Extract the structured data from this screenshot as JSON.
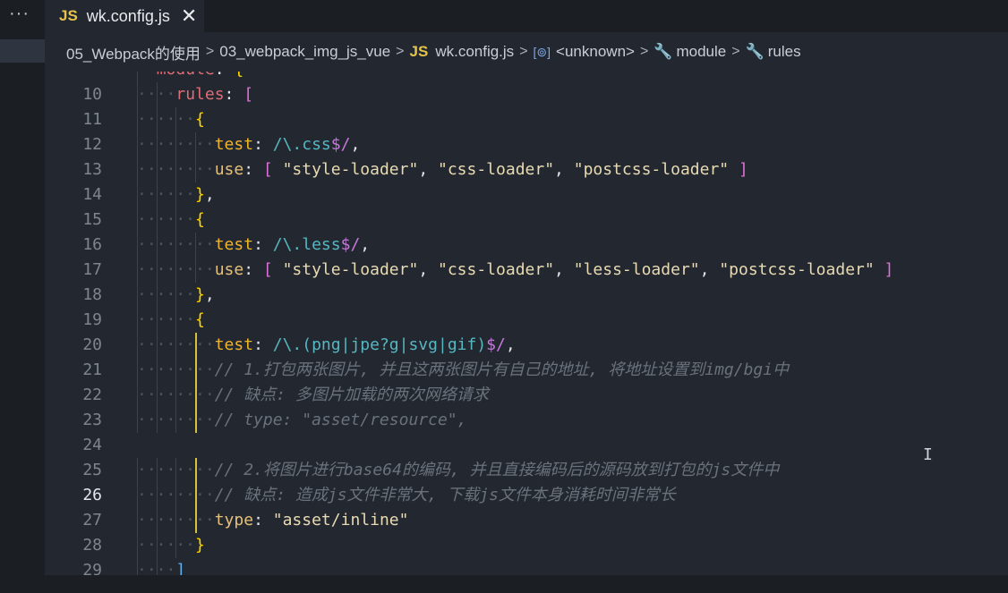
{
  "app": {
    "tab": {
      "icon": "JS",
      "filename": "wk.config.js",
      "close": "✕"
    },
    "breadcrumb": {
      "items": [
        "05_Webpack的使用",
        "03_webpack_img_js_vue",
        "wk.config.js",
        "<unknown>",
        "module",
        "rules"
      ],
      "js_icon": "JS"
    },
    "cursor_line": 26
  },
  "lines": [
    {
      "n": "",
      "text": "module: {"
    },
    {
      "n": "10",
      "text": "rules: ["
    },
    {
      "n": "11",
      "text": "{"
    },
    {
      "n": "12",
      "text": "test: /\\.css$/,"
    },
    {
      "n": "13",
      "text": "use: [ \"style-loader\", \"css-loader\", \"postcss-loader\" ]"
    },
    {
      "n": "14",
      "text": "},"
    },
    {
      "n": "15",
      "text": "{"
    },
    {
      "n": "16",
      "text": "test: /\\.less$/,"
    },
    {
      "n": "17",
      "text": "use: [ \"style-loader\", \"css-loader\", \"less-loader\", \"postcss-loader\" ]"
    },
    {
      "n": "18",
      "text": "},"
    },
    {
      "n": "19",
      "text": "{"
    },
    {
      "n": "20",
      "text": "test: /\\.(png|jpe?g|svg|gif)$/,"
    },
    {
      "n": "21",
      "text": "// 1.打包两张图片, 并且这两张图片有自己的地址, 将地址设置到img/bgi中"
    },
    {
      "n": "22",
      "text": "// 缺点: 多图片加载的两次网络请求"
    },
    {
      "n": "23",
      "text": "// type: \"asset/resource\","
    },
    {
      "n": "24",
      "text": ""
    },
    {
      "n": "25",
      "text": "// 2.将图片进行base64的编码, 并且直接编码后的源码放到打包的js文件中"
    },
    {
      "n": "26",
      "text": "// 缺点: 造成js文件非常大, 下载js文件本身消耗时间非常长"
    },
    {
      "n": "27",
      "text": "type: \"asset/inline\""
    },
    {
      "n": "28",
      "text": "}"
    },
    {
      "n": "29",
      "text": "]"
    }
  ],
  "icons": {
    "more": "more-horizontal-icon",
    "symbol": "symbol-variable-icon",
    "wrench": "wrench-icon",
    "chevron": "chevron-right-icon",
    "close": "close-icon"
  },
  "colors": {
    "accent_js": "#e6c34a",
    "active_indent_guide": "#d4c23e",
    "background": "#232830"
  }
}
